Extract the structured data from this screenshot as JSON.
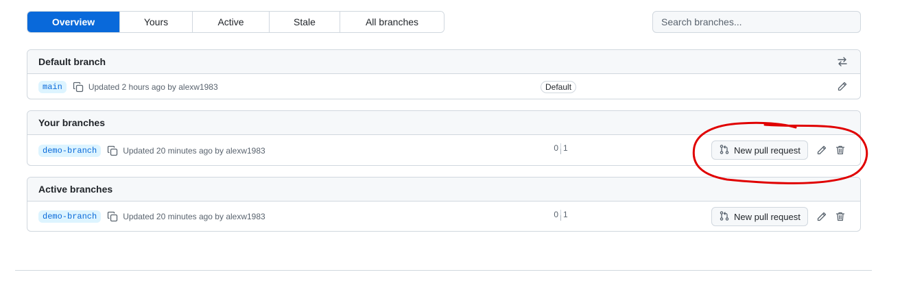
{
  "tabs": [
    {
      "label": "Overview",
      "selected": true
    },
    {
      "label": "Yours",
      "selected": false
    },
    {
      "label": "Active",
      "selected": false
    },
    {
      "label": "Stale",
      "selected": false
    },
    {
      "label": "All branches",
      "selected": false
    }
  ],
  "search": {
    "placeholder": "Search branches..."
  },
  "default_section": {
    "title": "Default branch",
    "row": {
      "branch": "main",
      "updated": "Updated 2 hours ago by alexw1983",
      "badge": "Default"
    }
  },
  "your_section": {
    "title": "Your branches",
    "row": {
      "branch": "demo-branch",
      "updated": "Updated 20 minutes ago by alexw1983",
      "behind": "0",
      "ahead": "1",
      "pr_label": "New pull request"
    }
  },
  "active_section": {
    "title": "Active branches",
    "row": {
      "branch": "demo-branch",
      "updated": "Updated 20 minutes ago by alexw1983",
      "behind": "0",
      "ahead": "1",
      "pr_label": "New pull request"
    }
  },
  "colors": {
    "accent": "#0969da",
    "annotation": "#e00000"
  },
  "icons": [
    "copy-icon",
    "switch-icon",
    "pencil-icon",
    "trash-icon",
    "git-pull-request-icon"
  ]
}
